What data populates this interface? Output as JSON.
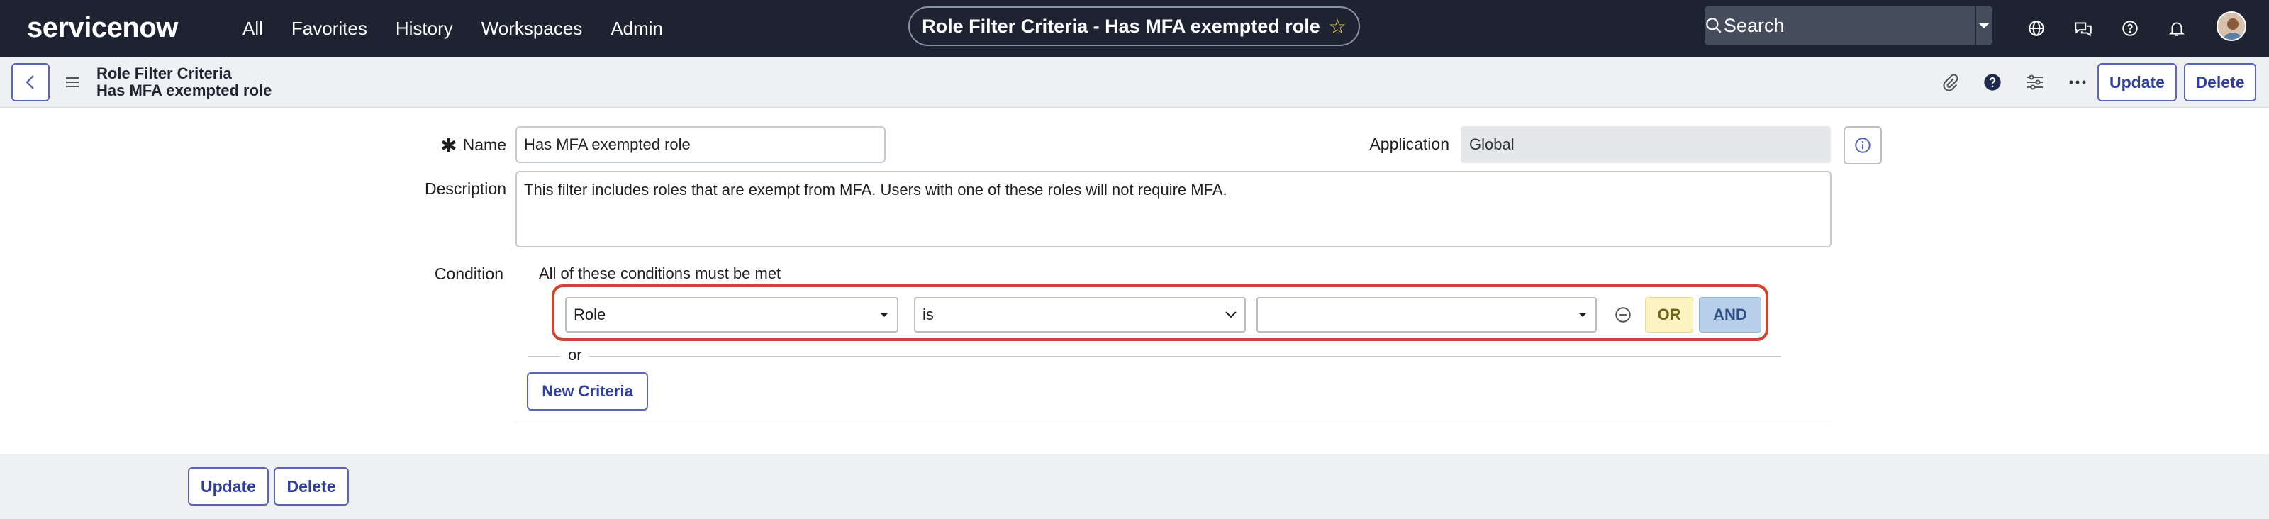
{
  "nav": {
    "logo": "servicenow",
    "items": [
      "All",
      "Favorites",
      "History",
      "Workspaces",
      "Admin"
    ],
    "title_pill": "Role Filter Criteria - Has MFA exempted role",
    "search_placeholder": "Search",
    "icons": [
      "globe-icon",
      "chat-icon",
      "help-icon",
      "bell-icon"
    ]
  },
  "subheader": {
    "title_line1": "Role Filter Criteria",
    "title_line2": "Has MFA exempted role",
    "update_label": "Update",
    "delete_label": "Delete",
    "icons": [
      "paperclip-icon",
      "question-circle-icon",
      "settings-sliders-icon",
      "more-icon"
    ]
  },
  "form": {
    "name_label": "Name",
    "name_value": "Has MFA exempted role",
    "application_label": "Application",
    "application_value": "Global",
    "description_label": "Description",
    "description_value": "This filter includes roles that are exempt from MFA. Users with one of these roles will not require MFA.",
    "condition_label": "Condition",
    "condition_heading": "All of these conditions must be met",
    "condition": {
      "field": "Role",
      "operator": "is",
      "value": ""
    },
    "or_button": "OR",
    "and_button": "AND",
    "or_separator": "or",
    "new_criteria": "New Criteria"
  },
  "footer": {
    "update_label": "Update",
    "delete_label": "Delete"
  },
  "colors": {
    "nav_bg": "#1d2330",
    "accent": "#2e3f9e",
    "highlight": "#d1432d",
    "or_bg": "#fbf3c2",
    "and_bg": "#b7cfe8"
  }
}
